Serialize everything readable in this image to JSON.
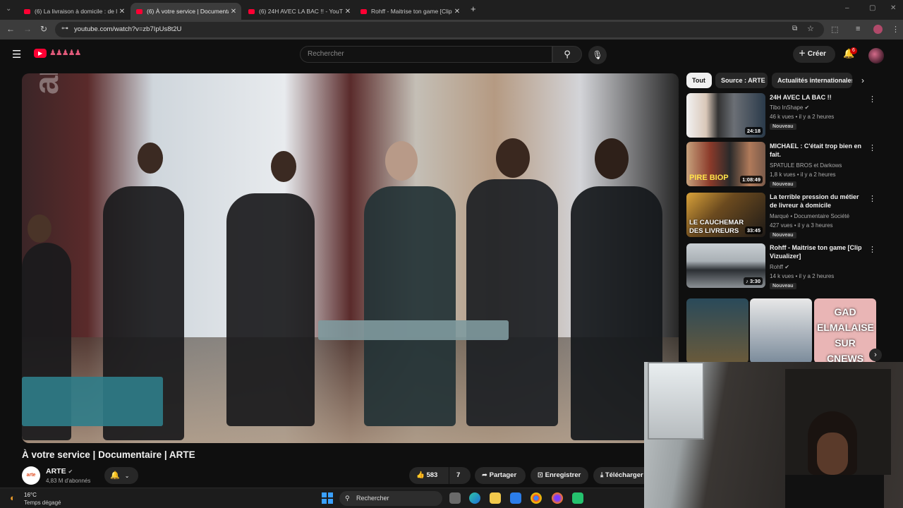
{
  "browser": {
    "tabs": [
      {
        "title": "(6) La livraison à domicile : de l'"
      },
      {
        "title": "(6) À votre service | Documenta"
      },
      {
        "title": "(6) 24H AVEC LA BAC !! - YouTu"
      },
      {
        "title": "Rohff - Maitrise ton game [Clip"
      }
    ],
    "url": "youtube.com/watch?v=zb7IpUs8t2U"
  },
  "youtube": {
    "search_placeholder": "Rechercher",
    "create_label": "Créer",
    "notif_count": "6"
  },
  "video": {
    "title": "À votre service | Documentaire | ARTE",
    "watermark": "arte",
    "channel": "ARTE",
    "channel_logo": "arte",
    "subscribers": "4,83 M d'abonnés",
    "likes": "583",
    "dislikes": "7",
    "share": "Partager",
    "save": "Enregistrer",
    "download": "Télécharger"
  },
  "chips": [
    "Tout",
    "Source : ARTE",
    "Actualités internationales"
  ],
  "recommendations": [
    {
      "title": "24H AVEC LA BAC !!",
      "channel": "Tibo InShape",
      "meta": "46 k vues • il y a 2 heures",
      "duration": "24:18",
      "badge": "Nouveau"
    },
    {
      "title": "MICHAEL : C'était trop bien en fait.",
      "channel": "SPATULE BROS et Darkows",
      "meta": "1,8 k vues • il y a 2 heures",
      "duration": "1:08:49",
      "badge": "Nouveau",
      "thumb_text": "PIRE BIOP"
    },
    {
      "title": "La terrible pression du métier de livreur à domicile",
      "channel": "Marqué • Documentaire Société",
      "meta": "427 vues • il y a 3 heures",
      "duration": "33:45",
      "badge": "Nouveau",
      "thumb_text": "LE CAUCHEMAR DES LIVREURS"
    },
    {
      "title": "Rohff - Maitrise ton game [Clip Vizualizer]",
      "channel": "Rohff",
      "meta": "14 k vues • il y a 2 heures",
      "duration": "3:30",
      "badge": "Nouveau"
    }
  ],
  "shorts_text": "GAD ELMALAISE SUR CNEWS",
  "taskbar": {
    "temperature": "16°C",
    "weather": "Temps dégagé",
    "search": "Rechercher"
  },
  "colors": {
    "bg": "#0f0f0f",
    "youtube_red": "#ff0033",
    "chip_selected": "#f1f1f1"
  }
}
